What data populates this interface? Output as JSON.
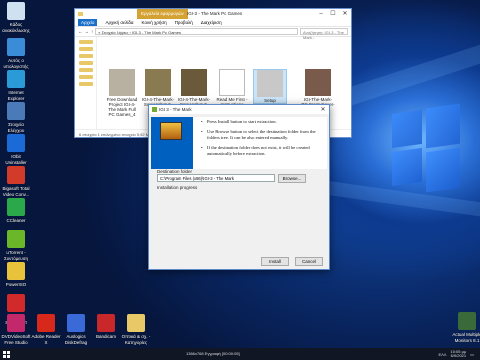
{
  "desktop": {
    "icons": [
      {
        "label": "Κάδος ανακύκλωσης",
        "icon": "recycle-bin-icon",
        "color": "#cfe0f0"
      },
      {
        "label": "Αυτός ο υπολογιστής",
        "icon": "computer-icon",
        "color": "#3a8bd8"
      },
      {
        "label": "Internet Explorer",
        "icon": "ie-icon",
        "color": "#2a9ad8"
      },
      {
        "label": "Στοιχεία Ελέγχου",
        "icon": "control-panel-icon",
        "color": "#4a7ab8"
      },
      {
        "label": "IObit Uninstaller",
        "icon": "iobit-icon",
        "color": "#1a6ad8"
      },
      {
        "label": "Bigasoft Total Video Conv...",
        "icon": "video-converter-icon",
        "color": "#d23a2a"
      },
      {
        "label": "CCleaner",
        "icon": "ccleaner-icon",
        "color": "#2aa84a"
      },
      {
        "label": "uTorrent - Συντόμευση",
        "icon": "utorrent-icon",
        "color": "#6ab82a"
      },
      {
        "label": "PowerISO",
        "icon": "poweriso-icon",
        "color": "#e8c23a"
      },
      {
        "label": "Nero StartSmart",
        "icon": "nero-icon",
        "color": "#d22a2a"
      }
    ],
    "bottom_icons": [
      {
        "label": "DVDVideoSoft Free Studio",
        "icon": "dvdvideosoft-icon",
        "color": "#c2286a"
      },
      {
        "label": "Adobe Reader X",
        "icon": "adobe-reader-icon",
        "color": "#d8281c"
      },
      {
        "label": "Auslogics DiskDefrag",
        "icon": "diskdefrag-icon",
        "color": "#3a6ad8"
      },
      {
        "label": "Bandicam",
        "icon": "bandicam-icon",
        "color": "#c8282a"
      },
      {
        "label": "Οπτικά & σχ. - Κατηγορίες",
        "icon": "folder-icon",
        "color": "#e8c867"
      }
    ],
    "right_icon": {
      "label": "Actual Multiple Monitors 8.1",
      "icon": "monitors-icon",
      "color": "#3a6a3a"
    }
  },
  "explorer": {
    "ribbon_context_tab": "Εργαλεία εφαρμογών",
    "title": "IGI-3 - The Mark  Pc Games",
    "ribbon_tabs": [
      "Αρχείο",
      "Αρχική σελίδα",
      "Κοινή χρήση",
      "Προβολή",
      "Διαχείριση"
    ],
    "address_path": "«  Στοιχεία λήψεις  ›  IGI-3 - The Mark  Pc Games",
    "search_placeholder": "Αναζήτηση: IGI-3 - The Mark...",
    "files": [
      {
        "name": "Free Download Project IGI-4-The Mark Full PC Games_4",
        "thumb": "#b8b0a0"
      },
      {
        "name": "IGI-4-The-Mark-Screenshot-2-300x232",
        "thumb": "#8a7a52"
      },
      {
        "name": "IGI-4-The-Mark-Screenshot-3-300x232",
        "thumb": "#6a5a3a"
      },
      {
        "name": "Read Me First - Instructions",
        "thumb": "#ffffff"
      },
      {
        "name": "Setup",
        "thumb": "#c8c8c8"
      },
      {
        "name": "IGI-The-Mark-PC-Front-Cover-45206",
        "thumb": "#7a5a4a"
      }
    ],
    "status": "6 στοιχεία   1 επιλεγμένο στοιχείο 5,92 MB"
  },
  "installer": {
    "title": "IGI 3 - The Mark",
    "bullets": [
      "Press Install button to start extraction.",
      "Use Browse button to select the destination folder from the folders tree. It can be also entered manually.",
      "If the destination folder does not exist, it will be created automatically before extraction."
    ],
    "destination_label": "Destination folder",
    "destination_value": "C:\\Program Files (x86)\\IGI-3 - The Mark",
    "browse_label": "Browse...",
    "progress_label": "Installation progress",
    "progress": 0,
    "install_label": "Install",
    "cancel_label": "Cancel"
  },
  "taskbar": {
    "center_text": "1366x768  Εγγραφή [00:00:05]",
    "clock_time": "10:05 μμ",
    "clock_date": "6/9/2021",
    "language": "ΕΛΛ"
  }
}
